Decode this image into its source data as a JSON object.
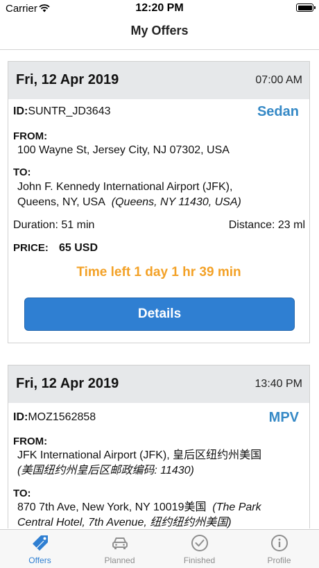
{
  "status_bar": {
    "carrier": "Carrier",
    "time": "12:20 PM"
  },
  "nav": {
    "title": "My Offers"
  },
  "offers": [
    {
      "date": "Fri, 12 Apr 2019",
      "time": "07:00 AM",
      "id_label": "ID:",
      "id_value": "SUNTR_JD3643",
      "vehicle": "Sedan",
      "from_label": "FROM:",
      "from_address": "100 Wayne St, Jersey City, NJ 07302, USA",
      "to_label": "TO:",
      "to_address_line1": "John F. Kennedy International Airport (JFK),",
      "to_address_line2": "Queens, NY, USA",
      "to_address_extra": "(Queens, NY 11430, USA)",
      "duration": "Duration: 51 min",
      "distance": "Distance: 23 ml",
      "price_label": "PRICE:",
      "price_value": "65 USD",
      "time_left": "Time left 1 day 1 hr 39 min",
      "details_label": "Details"
    },
    {
      "date": "Fri, 12 Apr 2019",
      "time": "13:40 PM",
      "id_label": "ID:",
      "id_value": "MOZ1562858",
      "vehicle": "MPV",
      "from_label": "FROM:",
      "from_address": "JFK International Airport (JFK), 皇后区纽约州美国",
      "from_address_extra_a": "(美国纽约州皇后区邮政编码: ",
      "from_address_extra_b": "11430)",
      "to_label": "TO:",
      "to_address_line1": "870 7th Ave, New York, NY 10019美国",
      "to_address_extra_a": "(The Park",
      "to_address_extra_b": "Central Hotel, 7th Avenue,",
      "to_address_extra_c": "纽约纽约州美国)"
    }
  ],
  "tabs": [
    {
      "label": "Offers",
      "icon": "tag-icon",
      "active": true
    },
    {
      "label": "Planned",
      "icon": "car-icon",
      "active": false
    },
    {
      "label": "Finished",
      "icon": "checkmark-circle-icon",
      "active": false
    },
    {
      "label": "Profile",
      "icon": "info-circle-icon",
      "active": false
    }
  ],
  "colors": {
    "accent": "#2f7fd2",
    "vehicle": "#3589c6",
    "time_left": "#f3a126",
    "header_bg": "#e6e8ea"
  }
}
